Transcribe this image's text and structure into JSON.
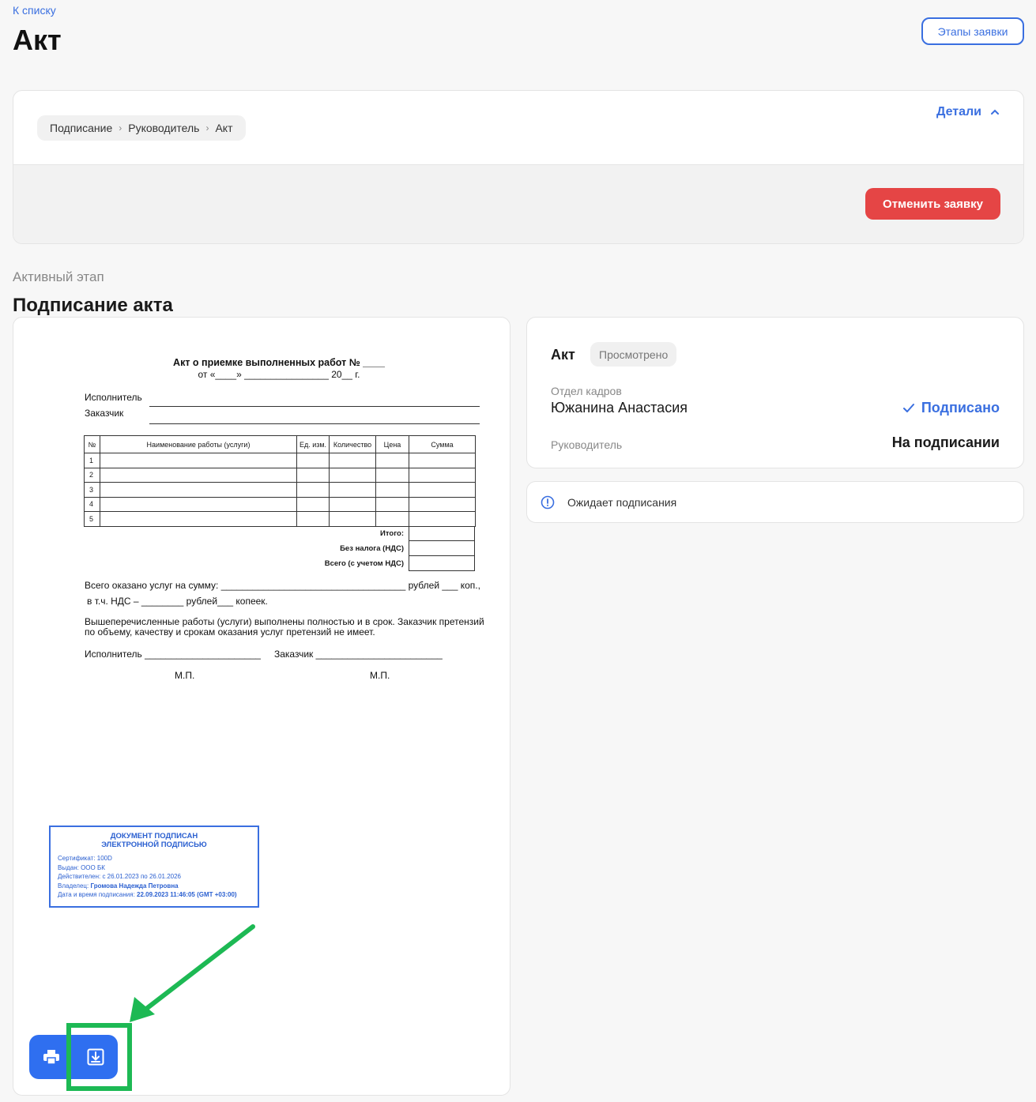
{
  "header": {
    "back_link": "К списку",
    "title": "Акт",
    "stages_button": "Этапы заявки"
  },
  "top_card": {
    "breadcrumb": [
      "Подписание",
      "Руководитель",
      "Акт"
    ],
    "details_label": "Детали",
    "cancel_button": "Отменить заявку"
  },
  "stage": {
    "label": "Активный этап",
    "title": "Подписание акта"
  },
  "document": {
    "title": "Акт о приемке выполненных работ № ____",
    "date_line": "от «____» ________________ 20__ г.",
    "executor_label": "Исполнитель",
    "customer_label": "Заказчик",
    "table_headers": [
      "№",
      "Наименование работы (услуги)",
      "Ед. изм.",
      "Количество",
      "Цена",
      "Сумма"
    ],
    "row_numbers": [
      "1",
      "2",
      "3",
      "4",
      "5"
    ],
    "totals": [
      "Итого:",
      "Без налога (НДС)",
      "Всего (с учетом НДС)"
    ],
    "sum_line": "Всего оказано услуг на сумму: ___________________________________ рублей ___ коп.,",
    "vat_line": "в т.ч. НДС – ________ рублей___ копеек.",
    "statement": "Вышеперечисленные работы (услуги) выполнены полностью и в срок. Заказчик претензий по объему, качеству и срокам оказания услуг претензий не имеет.",
    "sign_executor": "Исполнитель ______________________",
    "sign_customer": "Заказчик ________________________",
    "mp": "М.П."
  },
  "stamp": {
    "heading_1": "ДОКУМЕНТ ПОДПИСАН",
    "heading_2": "ЭЛЕКТРОННОЙ ПОДПИСЬЮ",
    "certificate": "Сертификат: 100D",
    "issued": "Выдан: ООО БК",
    "valid": "Действителен: с 26.01.2023 по 26.01.2026",
    "owner_label": "Владелец:",
    "owner_name": "Громова Надежда Петровна",
    "datetime_label": "Дата и время подписания:",
    "datetime_value": "22.09.2023 11:46:05 (GMT +03:00)"
  },
  "signers": {
    "doc_name": "Акт",
    "badge": "Просмотрено",
    "dept1_label": "Отдел кадров",
    "dept1_name": "Южанина Анастасия",
    "dept1_status": "Подписано",
    "dept2_label": "Руководитель",
    "dept2_status": "На подписании"
  },
  "status": {
    "text": "Ожидает подписания"
  },
  "colors": {
    "accent": "#3a6fe0",
    "danger": "#e54545",
    "annotation": "#1db954"
  },
  "icons": {
    "print": "printer-icon",
    "download": "download-icon",
    "info": "info-icon",
    "check": "check-icon",
    "chevron": "chevron-up-icon"
  }
}
